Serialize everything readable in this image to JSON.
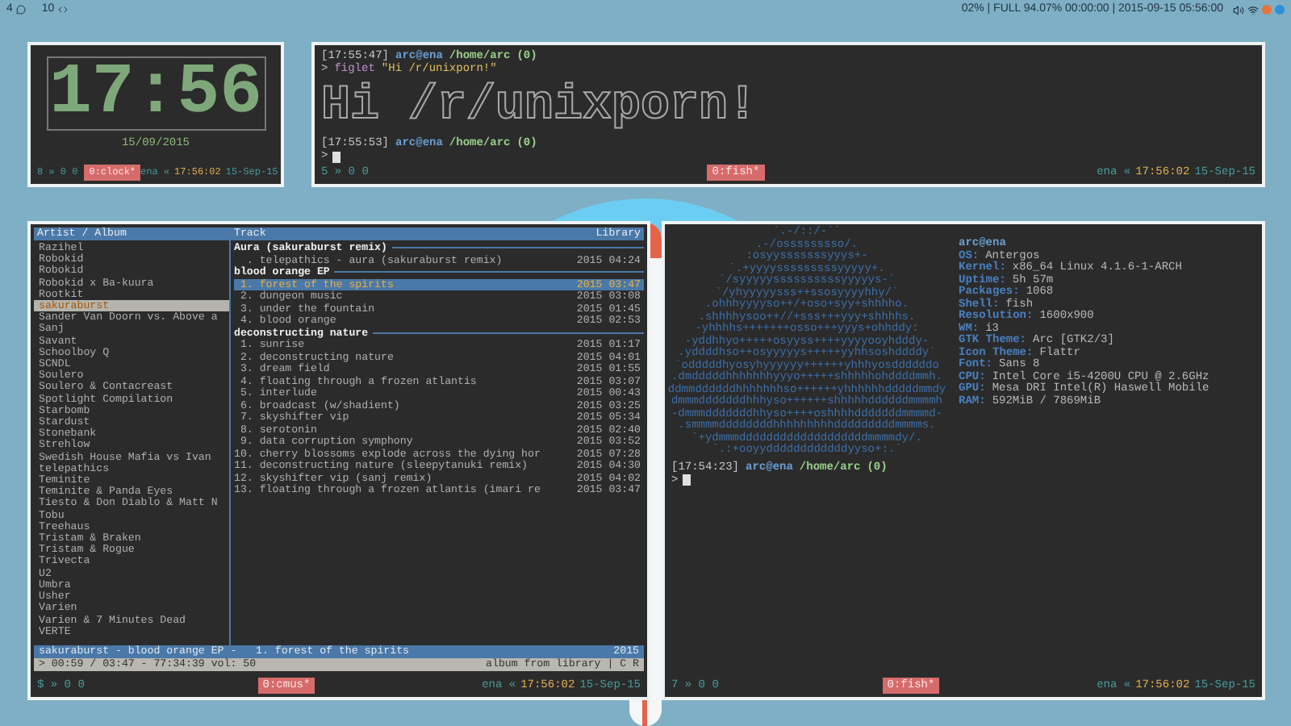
{
  "top_bar": {
    "workspaces": [
      {
        "kind": "chat",
        "count": "4"
      },
      {
        "kind": "code",
        "count": "10"
      }
    ],
    "status": "02% | FULL 94.07% 00:00:00 | 2015-09-15 05:56:00"
  },
  "clock_window": {
    "time": "17:56",
    "date": "15/09/2015",
    "status_bar": {
      "left": "8 » 0 0",
      "window": "0:clock*",
      "host": "ena «",
      "time": "17:56:02",
      "date": "15-Sep-15"
    }
  },
  "terminal_window": {
    "lines": [
      {
        "kind": "prompt",
        "time": "[17:55:47]",
        "user": "arc@ena",
        "path": "/home/arc",
        "status": "(0)"
      },
      {
        "kind": "command",
        "prompt_char": ">",
        "command": "figlet",
        "argument": "\"Hi /r/unixporn!\""
      },
      {
        "kind": "figlet",
        "text": "Hi /r/unixporn!"
      },
      {
        "kind": "prompt",
        "time": "[17:55:53]",
        "user": "arc@ena",
        "path": "/home/arc",
        "status": "(0)"
      },
      {
        "kind": "input",
        "prompt_char": ">"
      }
    ],
    "status_bar": {
      "left": "5 » 0 0",
      "window": "0:fish*",
      "host": "ena «",
      "time": "17:56:02",
      "date": "15-Sep-15"
    }
  },
  "cmus_window": {
    "columns": [
      "Artist / Album",
      "Track",
      "Library"
    ],
    "artists": [
      {
        "name": "Razihel",
        "selected": false
      },
      {
        "name": "Robokid",
        "selected": false
      },
      {
        "name": "Robokid",
        "selected": false
      },
      {
        "name": "Robokid x Ba-kuura",
        "selected": false
      },
      {
        "name": "Rootkit",
        "selected": false
      },
      {
        "name": "sakuraburst",
        "selected": true
      },
      {
        "name": "Sander Van Doorn vs. Above a",
        "selected": false
      },
      {
        "name": "Sanj",
        "selected": false
      },
      {
        "name": "Savant",
        "selected": false
      },
      {
        "name": "Schoolboy Q",
        "selected": false
      },
      {
        "name": "SCNDL",
        "selected": false
      },
      {
        "name": "Soulero",
        "selected": false
      },
      {
        "name": "Soulero & Contacreast",
        "selected": false
      },
      {
        "name": "Spotlight Compilation",
        "selected": false
      },
      {
        "name": "Starbomb",
        "selected": false
      },
      {
        "name": "Stardust",
        "selected": false
      },
      {
        "name": "Stonebank",
        "selected": false
      },
      {
        "name": "Strehlow",
        "selected": false
      },
      {
        "name": "Swedish House Mafia vs Ivan",
        "selected": false
      },
      {
        "name": "telepathics",
        "selected": false
      },
      {
        "name": "Teminite",
        "selected": false
      },
      {
        "name": "Teminite & Panda Eyes",
        "selected": false
      },
      {
        "name": "Tiesto & Don Diablo & Matt N",
        "selected": false
      },
      {
        "name": "Tobu",
        "selected": false
      },
      {
        "name": "Treehaus",
        "selected": false
      },
      {
        "name": "Tristam & Braken",
        "selected": false
      },
      {
        "name": "Tristam & Rogue",
        "selected": false
      },
      {
        "name": "Trivecta",
        "selected": false
      },
      {
        "name": "U2",
        "selected": false
      },
      {
        "name": "Umbra",
        "selected": false
      },
      {
        "name": "Usher",
        "selected": false
      },
      {
        "name": "Varien",
        "selected": false
      },
      {
        "name": "Varien & 7 Minutes Dead",
        "selected": false
      },
      {
        "name": "VERTE",
        "selected": false
      }
    ],
    "albums": [
      {
        "title": "Aura (sakuraburst remix)",
        "tracks": [
          {
            "title": "  . telepathics - aura (sakuraburst remix)",
            "year": "2015",
            "duration": "04:24",
            "selected": false
          }
        ]
      },
      {
        "title": "blood orange EP",
        "tracks": [
          {
            "title": " 1. forest of the spirits",
            "year": "2015",
            "duration": "03:47",
            "selected": true
          },
          {
            "title": " 2. dungeon music",
            "year": "2015",
            "duration": "03:08",
            "selected": false
          },
          {
            "title": " 3. under the fountain",
            "year": "2015",
            "duration": "01:45",
            "selected": false
          },
          {
            "title": " 4. blood orange",
            "year": "2015",
            "duration": "02:53",
            "selected": false
          }
        ]
      },
      {
        "title": "deconstructing nature",
        "tracks": [
          {
            "title": " 1. sunrise",
            "year": "2015",
            "duration": "01:17",
            "selected": false
          },
          {
            "title": " 2. deconstructing nature",
            "year": "2015",
            "duration": "04:01",
            "selected": false
          },
          {
            "title": " 3. dream field",
            "year": "2015",
            "duration": "01:55",
            "selected": false
          },
          {
            "title": " 4. floating through a frozen atlantis",
            "year": "2015",
            "duration": "03:07",
            "selected": false
          },
          {
            "title": " 5. interlude",
            "year": "2015",
            "duration": "00:43",
            "selected": false
          },
          {
            "title": " 6. broadcast (w/shadient)",
            "year": "2015",
            "duration": "03:25",
            "selected": false
          },
          {
            "title": " 7. skyshifter vip",
            "year": "2015",
            "duration": "05:34",
            "selected": false
          },
          {
            "title": " 8. serotonin",
            "year": "2015",
            "duration": "02:40",
            "selected": false
          },
          {
            "title": " 9. data corruption symphony",
            "year": "2015",
            "duration": "03:52",
            "selected": false
          },
          {
            "title": "10. cherry blossoms explode across the dying hor",
            "year": "2015",
            "duration": "07:28",
            "selected": false
          },
          {
            "title": "11. deconstructing nature (sleepytanuki remix)",
            "year": "2015",
            "duration": "04:30",
            "selected": false
          },
          {
            "title": "12. skyshifter vip (sanj remix)",
            "year": "2015",
            "duration": "04:02",
            "selected": false
          },
          {
            "title": "13. floating through a frozen atlantis (imari re",
            "year": "2015",
            "duration": "03:47",
            "selected": false
          }
        ]
      }
    ],
    "now_playing": {
      "text": "sakuraburst - blood orange EP -   1. forest of the spirits",
      "year": "2015"
    },
    "player_status": {
      "position": "> 00:59 / 03:47 - 77:34:39 vol: 50",
      "mode": "album from library | C R"
    },
    "status_bar": {
      "left": "$ » 0 0",
      "window": "0:cmus*",
      "host": "ena «",
      "time": "17:56:02",
      "date": "15-Sep-15"
    }
  },
  "neofetch_window": {
    "logo_lines": [
      "`.-/::/-``",
      ".-/osssssssso/.",
      ":osyysssssssyyys+-",
      "`.+yyyysssssssssyyyyy+.",
      "`/syyyyyssssssssssyyyyys-`",
      "`/yhyyyyysss++ssosyyyyhhy/`",
      ".ohhhyyyyso++/+oso+syy+shhhho.",
      ".shhhhysoo++//+sss+++yyy+shhhhs.",
      "-yhhhhs+++++++osso+++yyys+ohhddy:",
      "-yddhhyo+++++osyyss++++yyyyooyhdddy-",
      ".yddddhso++osyyyyys+++++yyhhsoshddddy`",
      "`odddddhyosyhyyyyyy++++++yhhhyosddddddo",
      ".dmdddddhhhhhhhyyyo+++++shhhhhohddddmmh.",
      "ddmmddddddhhhhhhhso++++++yhhhhhhdddddmmdy",
      "dmmmdddddddhhhyso++++++shhhhhddddddmmmmh",
      "-dmmmdddddddhhyso++++oshhhhdddddddmmmmd-",
      ".smmmmddddddddhhhhhhhhhdddddddddmmmms.",
      "`+ydmmmdddddddddddddddddddmmmmdy/.",
      "`.:+ooyyddddddddddddyyso+:.`"
    ],
    "info": [
      {
        "kind": "title",
        "text": "arc@ena"
      },
      {
        "kind": "field",
        "key": "OS:",
        "value": "Antergos"
      },
      {
        "kind": "field",
        "key": "Kernel:",
        "value": "x86_64 Linux 4.1.6-1-ARCH"
      },
      {
        "kind": "field",
        "key": "Uptime:",
        "value": "5h 57m"
      },
      {
        "kind": "field",
        "key": "Packages:",
        "value": "1068"
      },
      {
        "kind": "field",
        "key": "Shell:",
        "value": "fish"
      },
      {
        "kind": "field",
        "key": "Resolution:",
        "value": "1600x900"
      },
      {
        "kind": "field",
        "key": "WM:",
        "value": "i3"
      },
      {
        "kind": "field",
        "key": "GTK Theme:",
        "value": "Arc [GTK2/3]"
      },
      {
        "kind": "field",
        "key": "Icon Theme:",
        "value": "Flattr"
      },
      {
        "kind": "field",
        "key": "Font:",
        "value": "Sans 8"
      },
      {
        "kind": "field",
        "key": "CPU:",
        "value": "Intel Core i5-4200U CPU @ 2.6GHz"
      },
      {
        "kind": "field",
        "key": "GPU:",
        "value": "Mesa DRI Intel(R) Haswell Mobile"
      },
      {
        "kind": "field",
        "key": "RAM:",
        "value": "592MiB / 7869MiB"
      }
    ],
    "lines": [
      {
        "kind": "prompt",
        "time": "[17:54:23]",
        "user": "arc@ena",
        "path": "/home/arc",
        "status": "(0)"
      },
      {
        "kind": "input",
        "prompt_char": ">"
      }
    ],
    "status_bar": {
      "left": "7 » 0 0",
      "window": "0:fish*",
      "host": "ena «",
      "time": "17:56:02",
      "date": "15-Sep-15"
    }
  }
}
